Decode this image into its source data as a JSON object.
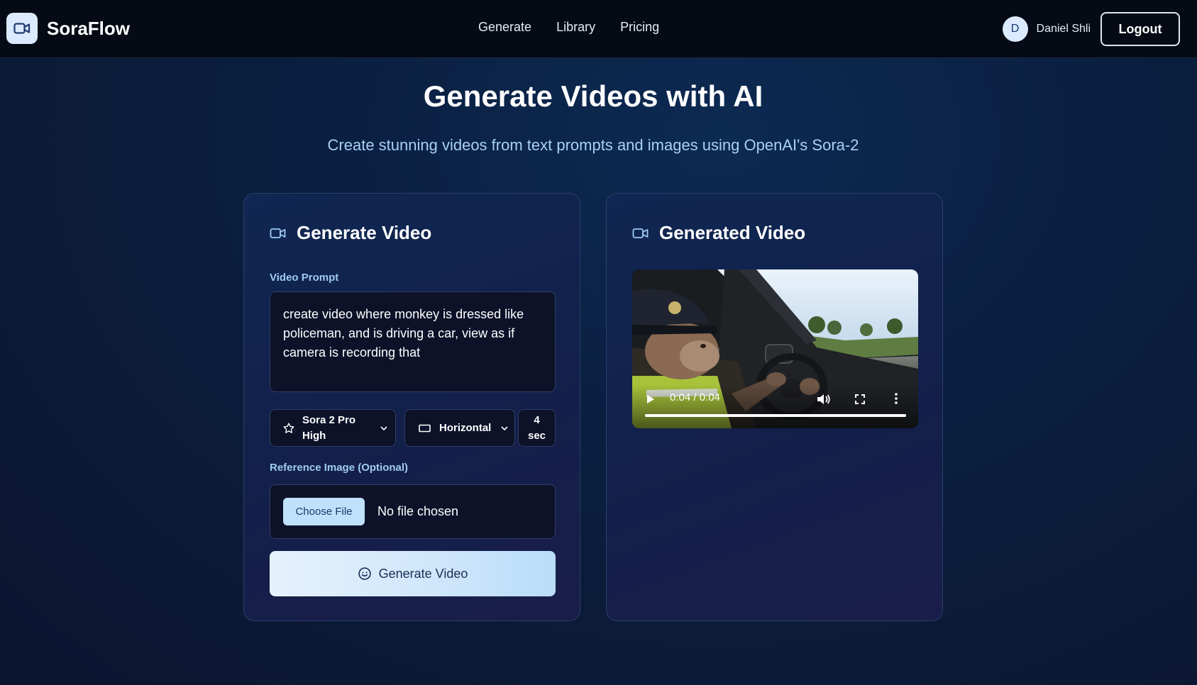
{
  "header": {
    "brand_name": "SoraFlow",
    "brand_icon": "video-camera-icon",
    "nav": [
      {
        "label": "Generate"
      },
      {
        "label": "Library"
      },
      {
        "label": "Pricing"
      }
    ],
    "user": {
      "avatar_initial": "D",
      "name": "Daniel Shli"
    },
    "logout_label": "Logout"
  },
  "hero": {
    "title": "Generate Videos with AI",
    "subtitle": "Create stunning videos from text prompts and images using OpenAI's Sora-2"
  },
  "generate_card": {
    "title": "Generate Video",
    "prompt_label": "Video Prompt",
    "prompt_value": "create video where monkey is dressed like policeman, and is driving a car, view as if camera is recording that",
    "model_select": {
      "line1": "Sora 2 Pro",
      "line2": "High",
      "icon": "star-icon"
    },
    "orientation_select": {
      "value": "Horizontal",
      "icon": "rectangle-icon"
    },
    "duration_select": {
      "line1": "4",
      "line2": "sec"
    },
    "reference_label": "Reference Image (Optional)",
    "choose_file_label": "Choose File",
    "file_status": "No file chosen",
    "generate_button_label": "Generate Video"
  },
  "result_card": {
    "title": "Generated Video",
    "video": {
      "time_display": "0:04 / 0:04",
      "progress": 1.0
    }
  },
  "colors": {
    "header_bg": "#050a14",
    "accent_light": "#dbeafe",
    "label_blue": "#9fcbf2",
    "subtitle_blue": "#a9d0f5"
  }
}
